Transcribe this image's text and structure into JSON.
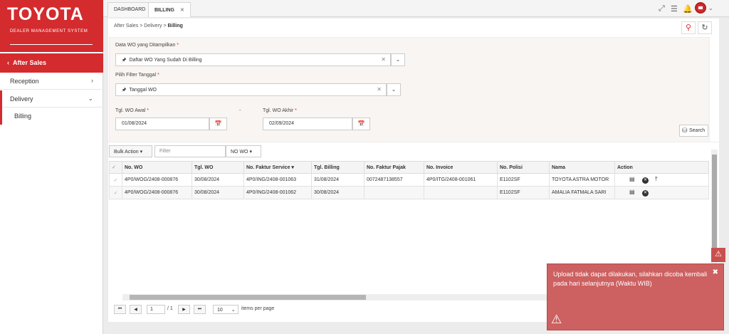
{
  "brand": {
    "logo": "TOYOTA",
    "subtitle": "DEALER MANAGEMENT SYSTEM"
  },
  "sidebar": {
    "section": "After Sales",
    "items": [
      {
        "label": "Reception"
      },
      {
        "label": "Delivery"
      },
      {
        "label": "Billing"
      }
    ]
  },
  "tabs": [
    {
      "label": "DASHBOARD"
    },
    {
      "label": "BILLING"
    }
  ],
  "breadcrumb": {
    "a": "After Sales",
    "b": "Delivery",
    "c": "Billing"
  },
  "form": {
    "wo_label": "Data WO yang Ditampilkan",
    "wo_value": "Daftar WO Yang Sudah Di Billing",
    "filter_label": "Pilih Filter Tanggal",
    "filter_value": "Tanggal WO",
    "start_label": "Tgl. WO Awal",
    "start_value": "01/08/2024",
    "end_label": "Tgl. WO Akhir",
    "end_value": "02/09/2024",
    "dash": "-",
    "search_label": "Search"
  },
  "grid": {
    "bulk_action": "Bulk Action",
    "filter_placeholder": "Filter",
    "filter_field": "NO WO",
    "columns": [
      "No. WO",
      "Tgl. WO",
      "No. Faktur Service",
      "Tgl. Billing",
      "No. Faktur Pajak",
      "No. Invoice",
      "No. Polisi",
      "Nama",
      "Action"
    ],
    "rows": [
      [
        "4P0/WOG/2408-000876",
        "30/08/2024",
        "4P0/ING/2408-001063",
        "31/08/2024",
        "0072487138557",
        "4P0/ITG/2408-001061",
        "E1102SF",
        "TOYOTA ASTRA MOTOR"
      ],
      [
        "4P0/WOG/2408-000876",
        "30/08/2024",
        "4P0/ING/2408-001062",
        "30/08/2024",
        "",
        "",
        "E1102SF",
        "AMALIA FATMALA SARI"
      ]
    ]
  },
  "pager": {
    "page": "1",
    "of": "/ 1",
    "size": "10",
    "size_label": "items per page"
  },
  "toast": {
    "message": "Upload tidak dapat dilakukan, silahkan dicoba kembali pada hari selanjutnya (Waktu WIB)"
  },
  "colors": {
    "brand_red": "#d42b2e",
    "toast_bg": "#cd6060"
  }
}
